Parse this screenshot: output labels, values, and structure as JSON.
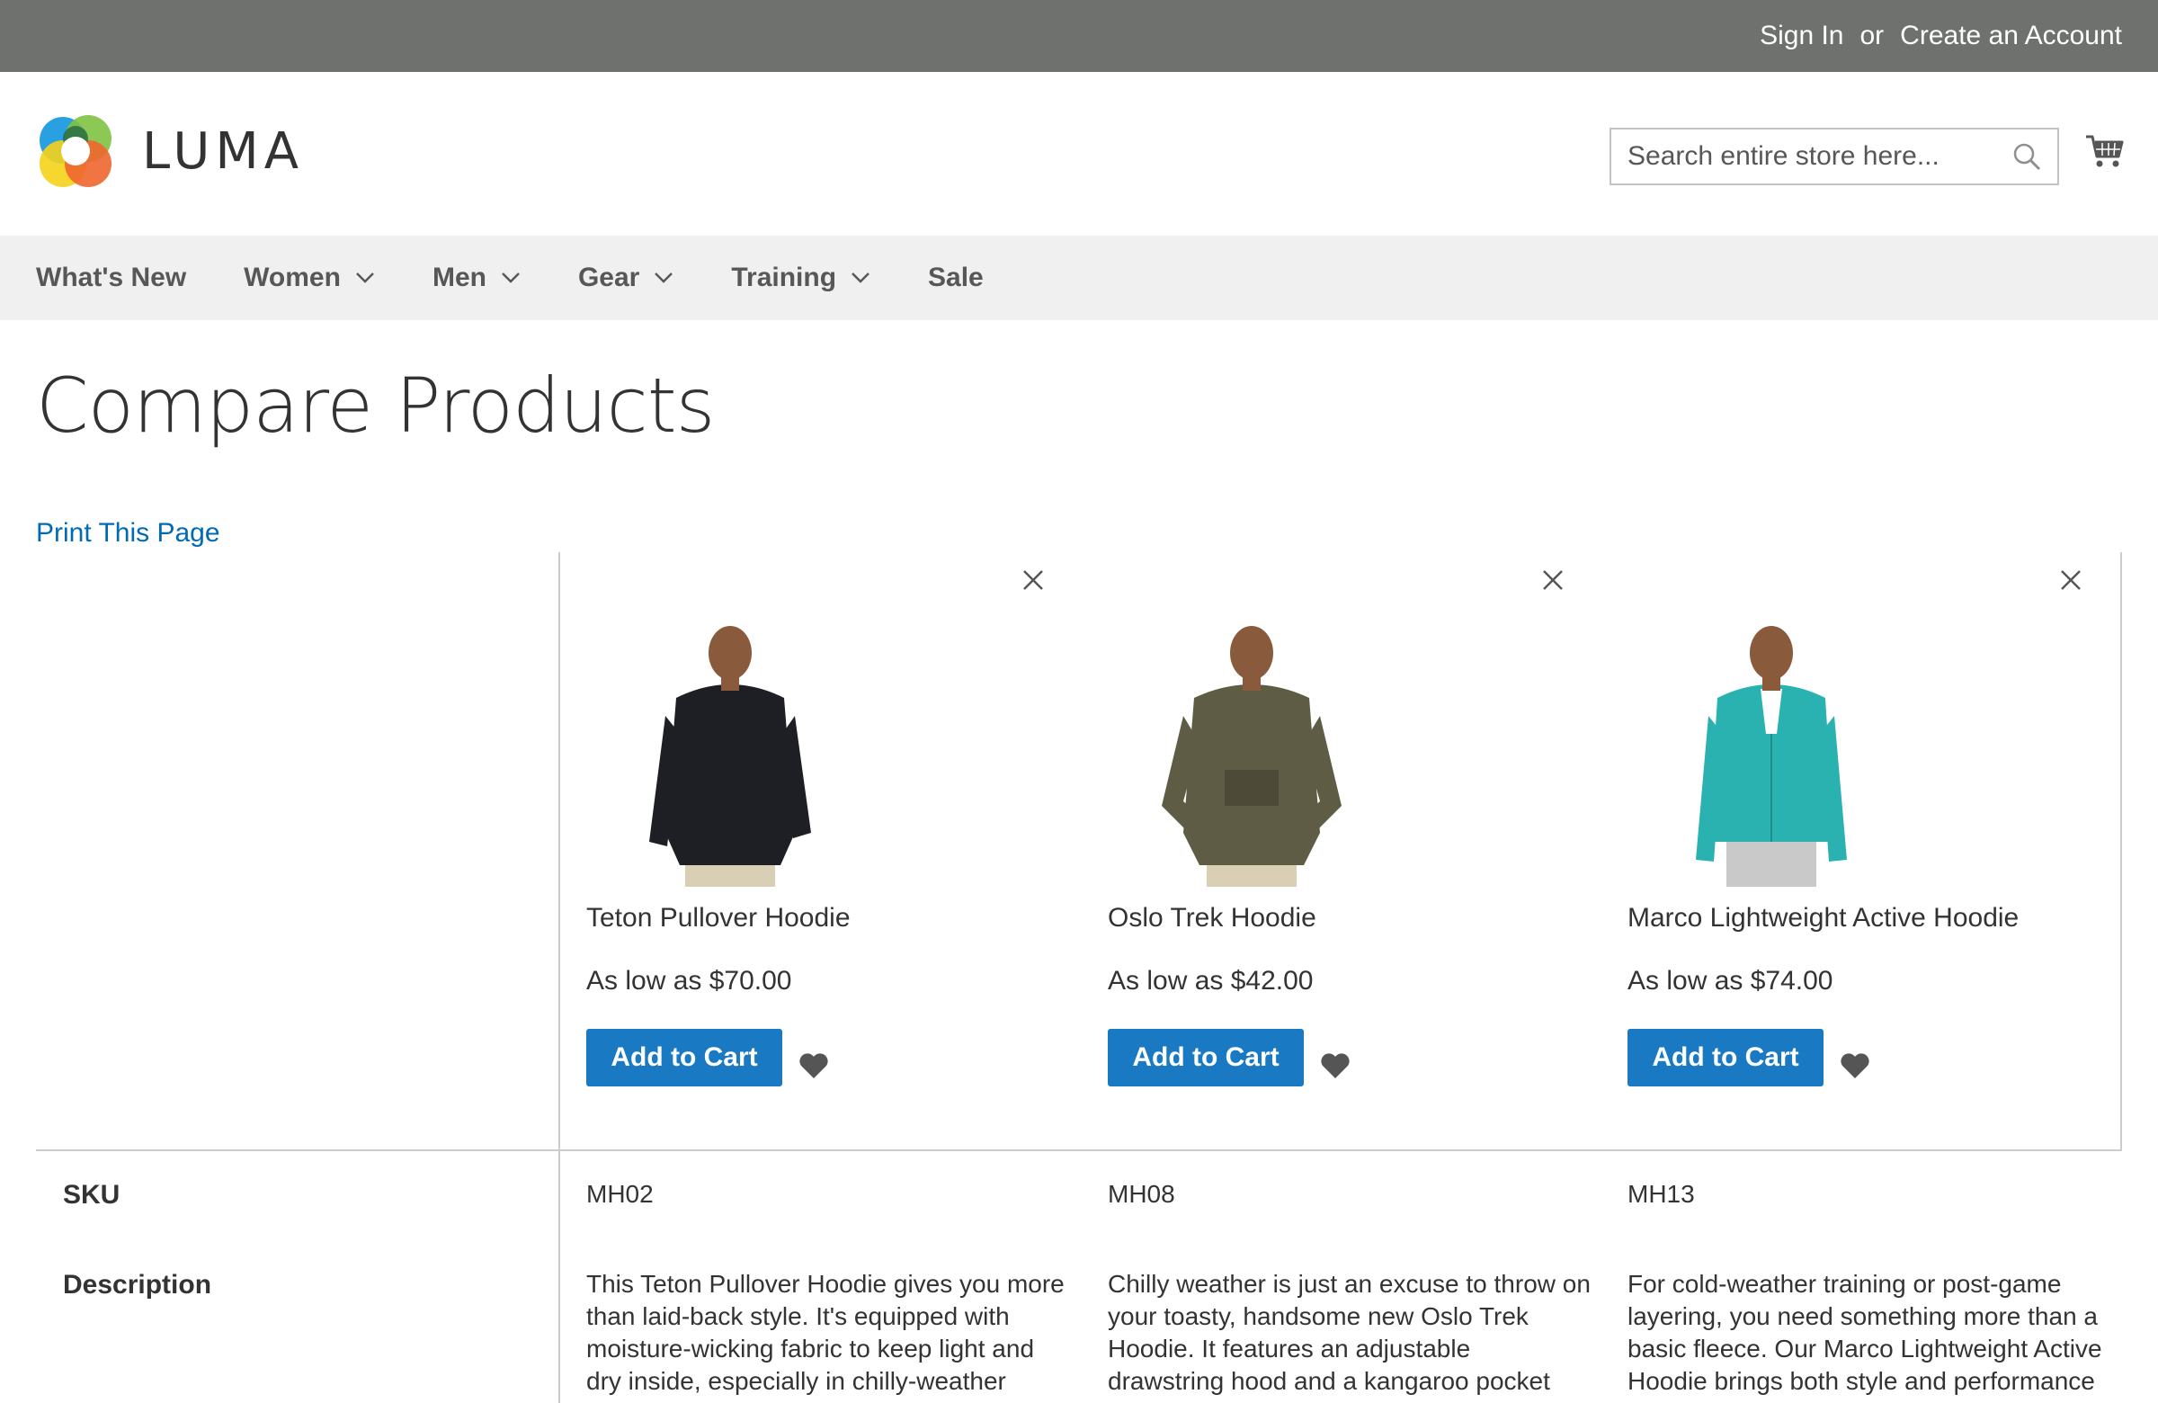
{
  "topbar": {
    "sign_in": "Sign In",
    "or": "or",
    "create_account": "Create an Account"
  },
  "header": {
    "logo_text": "LUMA",
    "search_placeholder": "Search entire store here...",
    "icons": {
      "search": "search-icon",
      "cart": "cart-icon"
    }
  },
  "nav": {
    "items": [
      {
        "label": "What's New",
        "has_dropdown": false
      },
      {
        "label": "Women",
        "has_dropdown": true
      },
      {
        "label": "Men",
        "has_dropdown": true
      },
      {
        "label": "Gear",
        "has_dropdown": true
      },
      {
        "label": "Training",
        "has_dropdown": true
      },
      {
        "label": "Sale",
        "has_dropdown": false
      }
    ]
  },
  "page": {
    "title": "Compare Products",
    "print_link": "Print This Page"
  },
  "compare": {
    "row_labels": {
      "sku": "SKU",
      "description": "Description"
    },
    "products": [
      {
        "name": "Teton Pullover Hoodie",
        "price": "As low as $70.00",
        "add_to_cart": "Add to Cart",
        "sku": "MH02",
        "description": "This Teton Pullover Hoodie gives you more than laid-back style. It's equipped with moisture-wicking fabric to keep light and dry inside, especially in chilly-weather",
        "image_color": "#1e1f24"
      },
      {
        "name": "Oslo Trek Hoodie",
        "price": "As low as $42.00",
        "add_to_cart": "Add to Cart",
        "sku": "MH08",
        "description": "Chilly weather is just an excuse to throw on your toasty, handsome new Oslo Trek Hoodie. It features an adjustable drawstring hood and a kangaroo pocket",
        "image_color": "#5e5c45"
      },
      {
        "name": "Marco Lightweight Active Hoodie",
        "price": "As low as $74.00",
        "add_to_cart": "Add to Cart",
        "sku": "MH13",
        "description": "For cold-weather training or post-game layering, you need something more than a basic fleece. Our Marco Lightweight Active Hoodie brings both style and performance",
        "image_color": "#2ab2b0"
      }
    ]
  },
  "colors": {
    "topbar": "#6e716e",
    "nav_bg": "#f0f0f0",
    "link": "#006bb4",
    "button": "#1979c3"
  }
}
